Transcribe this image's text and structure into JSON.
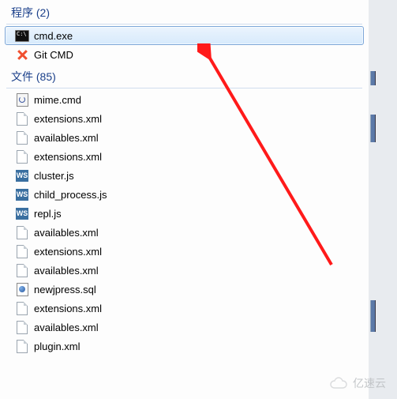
{
  "sections": {
    "programs": {
      "title": "程序 (2)"
    },
    "files": {
      "title": "文件 (85)"
    }
  },
  "programs": [
    {
      "icon": "cmd",
      "label": "cmd.exe",
      "selected": true
    },
    {
      "icon": "git",
      "label": "Git CMD"
    }
  ],
  "files": [
    {
      "icon": "cmdfile",
      "label": "mime.cmd"
    },
    {
      "icon": "file",
      "label": "extensions.xml"
    },
    {
      "icon": "file",
      "label": "availables.xml"
    },
    {
      "icon": "file",
      "label": "extensions.xml"
    },
    {
      "icon": "ws",
      "label": "cluster.js"
    },
    {
      "icon": "ws",
      "label": "child_process.js"
    },
    {
      "icon": "ws",
      "label": "repl.js"
    },
    {
      "icon": "file",
      "label": "availables.xml"
    },
    {
      "icon": "file",
      "label": "extensions.xml"
    },
    {
      "icon": "file",
      "label": "availables.xml"
    },
    {
      "icon": "sql",
      "label": "newjpress.sql"
    },
    {
      "icon": "file",
      "label": "extensions.xml"
    },
    {
      "icon": "file",
      "label": "availables.xml"
    },
    {
      "icon": "file",
      "label": "plugin.xml"
    }
  ],
  "watermark": "亿速云"
}
